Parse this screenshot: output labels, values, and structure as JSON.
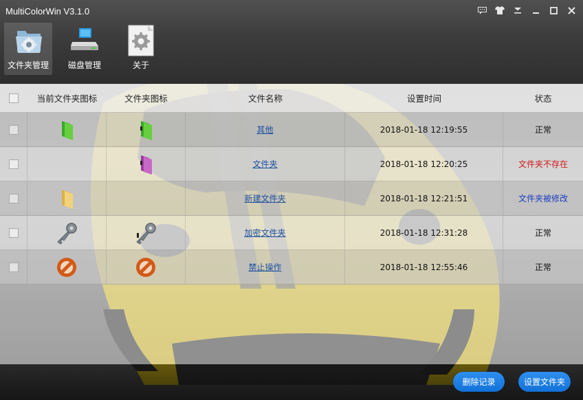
{
  "window": {
    "title": "MultiColorWin V3.1.0",
    "controls": [
      "chat-icon",
      "shirt-icon",
      "menu-icon",
      "minimize-icon",
      "maximize-icon",
      "close-icon"
    ]
  },
  "toolbar": {
    "items": [
      {
        "label": "文件夹管理",
        "icon": "folder-settings-icon",
        "active": true
      },
      {
        "label": "磁盘管理",
        "icon": "disk-icon",
        "active": false
      },
      {
        "label": "关于",
        "icon": "about-gear-icon",
        "active": false
      }
    ]
  },
  "table": {
    "headers": [
      "当前文件夹图标",
      "文件夹图标",
      "文件名称",
      "设置时间",
      "状态"
    ],
    "rows": [
      {
        "current_icon": "green-folder-icon",
        "folder_icon": "green-folder-icon",
        "name": "其他",
        "time": "2018-01-18 12:19:55",
        "status": "正常",
        "status_type": "normal"
      },
      {
        "current_icon": "",
        "folder_icon": "purple-folder-icon",
        "name": "文件夹",
        "time": "2018-01-18 12:20:25",
        "status": "文件夹不存在",
        "status_type": "missing"
      },
      {
        "current_icon": "yellow-folder-icon",
        "folder_icon": "",
        "name": "新建文件夹",
        "time": "2018-01-18 12:21:51",
        "status": "文件夹被修改",
        "status_type": "modified"
      },
      {
        "current_icon": "key-icon",
        "folder_icon": "key-icon",
        "name": "加密文件夹",
        "time": "2018-01-18 12:31:28",
        "status": "正常",
        "status_type": "normal"
      },
      {
        "current_icon": "forbidden-icon",
        "folder_icon": "forbidden-icon",
        "name": "禁止操作",
        "time": "2018-01-18 12:55:46",
        "status": "正常",
        "status_type": "normal"
      }
    ]
  },
  "actions": {
    "delete_label": "删除记录",
    "set_label": "设置文件夹"
  },
  "colors": {
    "accent_button": "#1a7fe6",
    "status_normal": "#111111",
    "status_missing": "#d01818",
    "status_modified": "#1a3fc0",
    "link": "#1b4f9e"
  }
}
